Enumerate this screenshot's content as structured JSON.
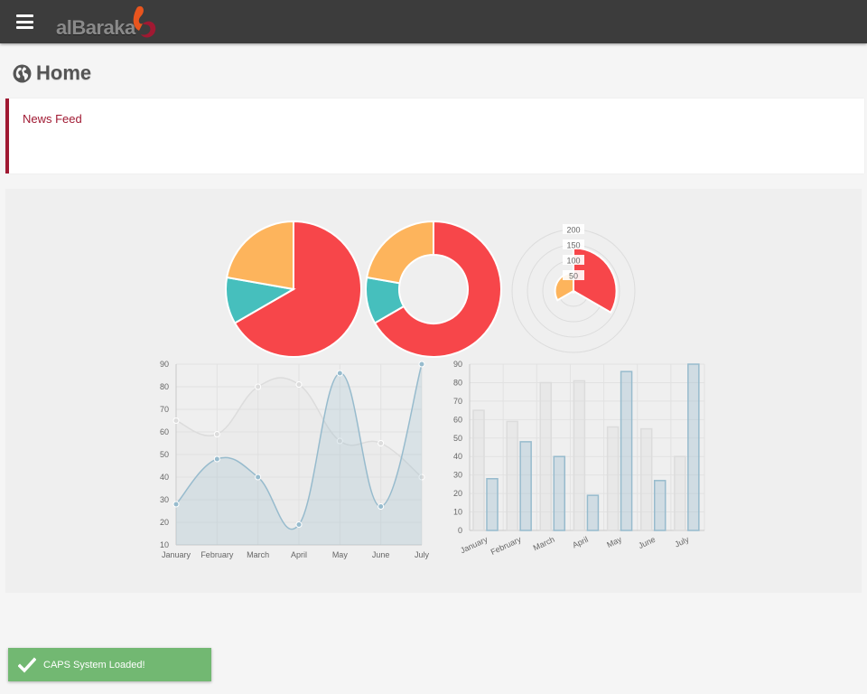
{
  "header": {
    "menu_icon": "hamburger-icon",
    "logo_text": "alBaraka"
  },
  "page": {
    "title": "Home",
    "title_icon": "globe-icon"
  },
  "news_feed": {
    "title": "News Feed"
  },
  "colors": {
    "red": "#f7464a",
    "teal": "#46bfbd",
    "yellow": "#fdb45c",
    "series_grey": "#dcdcdc",
    "series_blue": "#97bbcd",
    "accent": "#a01932",
    "toast": "#72b872"
  },
  "chart_data": [
    {
      "type": "pie",
      "values": [
        300,
        50,
        100
      ],
      "colors": [
        "#f7464a",
        "#46bfbd",
        "#fdb45c"
      ]
    },
    {
      "type": "pie",
      "variant": "doughnut",
      "values": [
        300,
        50,
        100
      ],
      "colors": [
        "#f7464a",
        "#46bfbd",
        "#fdb45c"
      ]
    },
    {
      "type": "pie",
      "variant": "polar-area",
      "values": [
        140,
        5,
        60
      ],
      "colors": [
        "#f7464a",
        "#46bfbd",
        "#fdb45c"
      ],
      "scale_ticks": [
        "200",
        "150",
        "100",
        "50"
      ],
      "rmax": 200
    },
    {
      "type": "line",
      "categories": [
        "January",
        "February",
        "March",
        "April",
        "May",
        "June",
        "July"
      ],
      "series": [
        {
          "values": [
            65,
            59,
            80,
            81,
            56,
            55,
            40
          ],
          "color": "#dcdcdc"
        },
        {
          "values": [
            28,
            48,
            40,
            19,
            86,
            27,
            90
          ],
          "color": "#97bbcd"
        }
      ],
      "yticks": [
        "10",
        "20",
        "30",
        "40",
        "50",
        "60",
        "70",
        "80",
        "90"
      ],
      "ylim": [
        10,
        90
      ]
    },
    {
      "type": "bar",
      "categories": [
        "January",
        "February",
        "March",
        "April",
        "May",
        "June",
        "July"
      ],
      "series": [
        {
          "values": [
            65,
            59,
            80,
            81,
            56,
            55,
            40
          ],
          "color": "#dcdcdc"
        },
        {
          "values": [
            28,
            48,
            40,
            19,
            86,
            27,
            90
          ],
          "color": "#97bbcd"
        }
      ],
      "yticks": [
        "0",
        "10",
        "20",
        "30",
        "40",
        "50",
        "60",
        "70",
        "80",
        "90"
      ],
      "ylim": [
        0,
        90
      ]
    }
  ],
  "toast": {
    "message": "CAPS System Loaded!",
    "icon": "check-icon"
  }
}
